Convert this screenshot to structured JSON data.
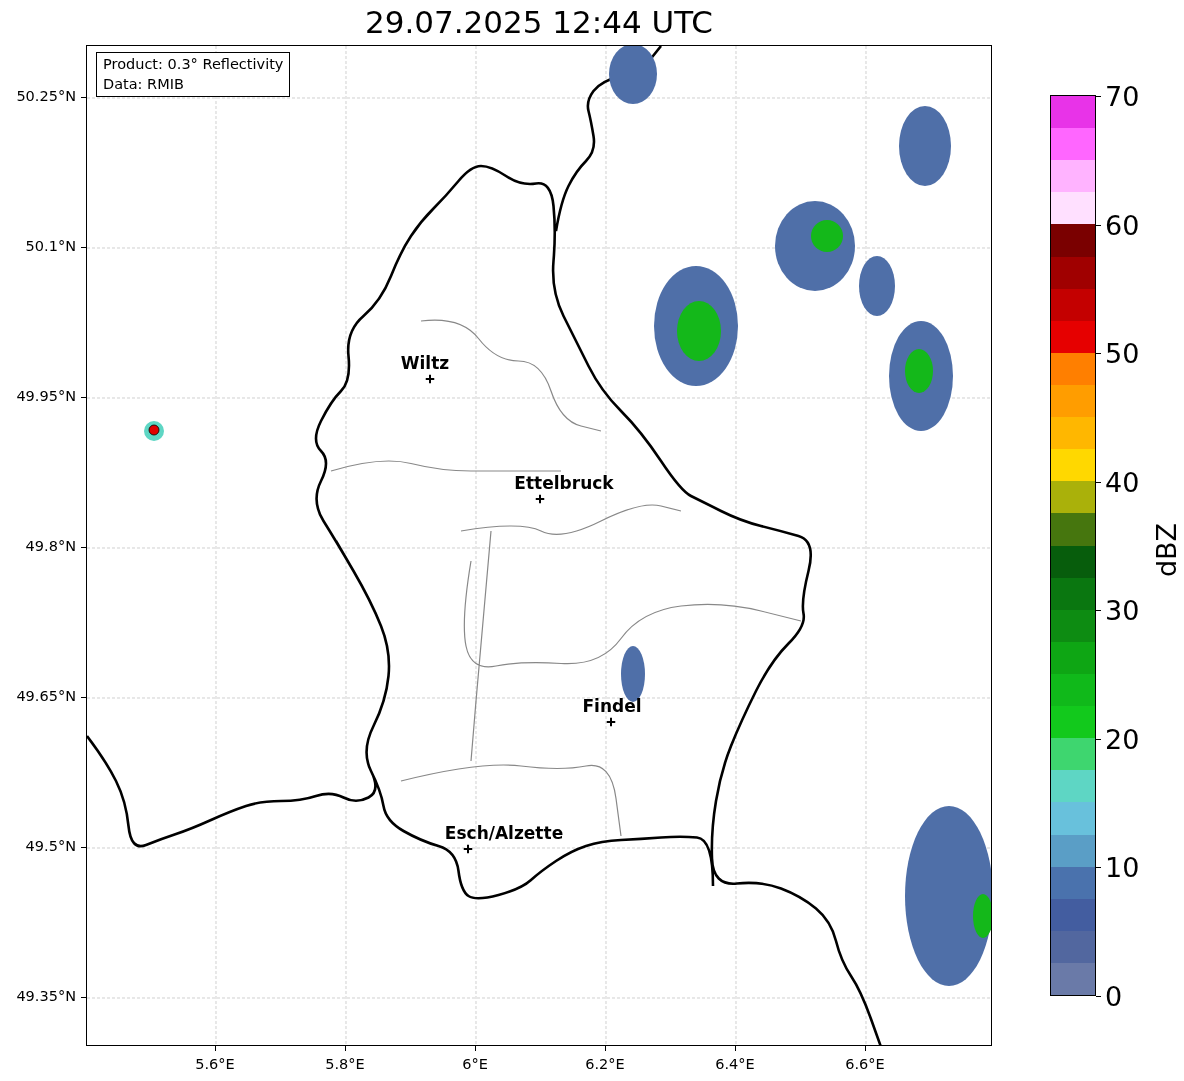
{
  "title": "29.07.2025 12:44 UTC",
  "info_box": [
    "Product: 0.3° Reflectivity",
    "Data: RMIB"
  ],
  "map": {
    "x_ticks": [
      "5.6°E",
      "5.8°E",
      "6°E",
      "6.2°E",
      "6.4°E",
      "6.6°E"
    ],
    "y_ticks": [
      "50.25°N",
      "50.1°N",
      "49.95°N",
      "49.8°N",
      "49.65°N",
      "49.5°N",
      "49.35°N"
    ],
    "cities": [
      {
        "name": "Wiltz"
      },
      {
        "name": "Ettelbruck"
      },
      {
        "name": "Findel"
      },
      {
        "name": "Esch/Alzette"
      }
    ]
  },
  "colorbar": {
    "label": "dBZ",
    "ticks": [
      "70",
      "60",
      "50",
      "40",
      "30",
      "20",
      "10",
      "0"
    ],
    "segments": [
      {
        "color": "#e833e8"
      },
      {
        "color": "#ff66ff"
      },
      {
        "color": "#ffb3ff"
      },
      {
        "color": "#ffe0ff"
      },
      {
        "color": "#7a0000"
      },
      {
        "color": "#a00000"
      },
      {
        "color": "#c40000"
      },
      {
        "color": "#e60000"
      },
      {
        "color": "#ff7f00"
      },
      {
        "color": "#ff9d00"
      },
      {
        "color": "#ffb700"
      },
      {
        "color": "#ffd800"
      },
      {
        "color": "#aab10a"
      },
      {
        "color": "#46760e"
      },
      {
        "color": "#075d0c"
      },
      {
        "color": "#0a7710"
      },
      {
        "color": "#0d8c12"
      },
      {
        "color": "#0ea614"
      },
      {
        "color": "#10b91a"
      },
      {
        "color": "#12c91c"
      },
      {
        "color": "#3ed66f"
      },
      {
        "color": "#5ed6c4"
      },
      {
        "color": "#68c1dc"
      },
      {
        "color": "#5a9ec6"
      },
      {
        "color": "#4a72ad"
      },
      {
        "color": "#435da0"
      },
      {
        "color": "#52679f"
      },
      {
        "color": "#6a7aa8"
      }
    ]
  }
}
